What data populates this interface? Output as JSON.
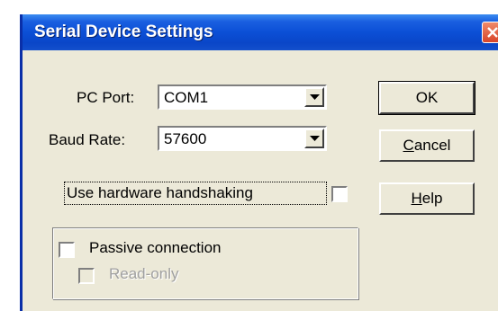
{
  "window": {
    "title": "Serial Device Settings"
  },
  "pc_port": {
    "label": "PC Port:",
    "value": "COM1"
  },
  "baud_rate": {
    "label": "Baud Rate:",
    "value": "57600"
  },
  "hardware_handshaking": {
    "label": "Use hardware handshaking",
    "checked": false
  },
  "passive_connection": {
    "label": "Passive connection",
    "checked": false
  },
  "read_only": {
    "label": "Read-only",
    "checked": false,
    "enabled": false
  },
  "buttons": {
    "ok": "OK",
    "cancel_underlined": "C",
    "cancel_rest": "ancel",
    "help_underlined": "H",
    "help_rest": "elp"
  },
  "icons": {
    "close": "close-icon",
    "dropdown": "chevron-down-icon"
  },
  "colors": {
    "titlebar": "#0b4fd6",
    "dialog_bg": "#ece9d8",
    "close_button": "#d8452a",
    "disabled_text": "#a0a0a0"
  }
}
